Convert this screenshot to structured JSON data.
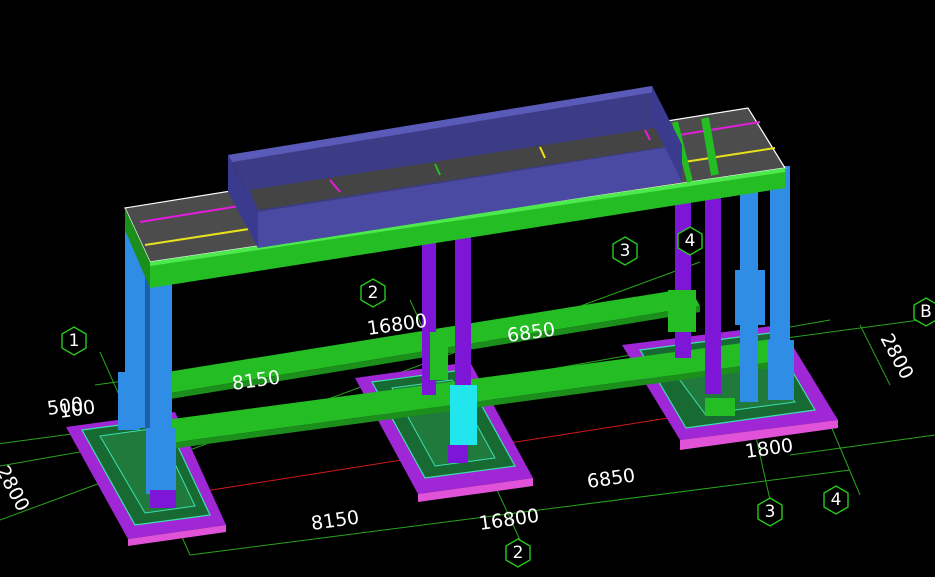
{
  "axes": {
    "numbered": [
      "1",
      "2",
      "3",
      "4"
    ],
    "lettered": [
      "B"
    ],
    "top_numbered": [
      "2",
      "3",
      "4"
    ]
  },
  "dimensions": {
    "bottom_total": "16800",
    "bottom_span_1_2": "8150",
    "bottom_span_2_3": "6850",
    "bottom_span_3_4": "1800",
    "right_width": "2800",
    "left_width": "2800",
    "top_total": "16800",
    "top_span_1_2": "8150",
    "top_span_2_3": "6850",
    "left_offset_a": "500",
    "left_offset_b": "100"
  },
  "colors": {
    "background": "#000000",
    "grid_line": "#2aa41e",
    "column_blue": "#2f8de6",
    "column_purple": "#7d16d6",
    "column_cyan": "#22e6ee",
    "beam_green": "#24be24",
    "tank_blue": "#4a4aa2",
    "foundation_magenta": "#9f27d6",
    "foundation_green": "#186a33",
    "slab_gray": "#4c4c4c",
    "rebar_yellow": "#e8e11c",
    "rebar_magenta": "#e41cdc",
    "red_line": "#d21a1a"
  }
}
